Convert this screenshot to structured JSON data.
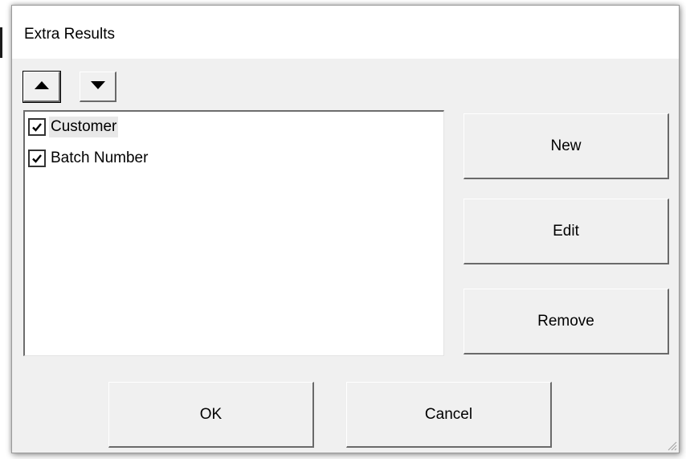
{
  "dialog": {
    "title": "Extra Results"
  },
  "toolbar": {
    "move_up_icon": "triangle-up-icon",
    "move_down_icon": "triangle-down-icon"
  },
  "results_list": {
    "items": [
      {
        "label": "Customer",
        "checked": true,
        "selected": true
      },
      {
        "label": "Batch Number",
        "checked": true,
        "selected": false
      }
    ]
  },
  "side_buttons": {
    "new_label": "New",
    "edit_label": "Edit",
    "remove_label": "Remove"
  },
  "footer_buttons": {
    "ok_label": "OK",
    "cancel_label": "Cancel"
  },
  "colors": {
    "dialog_background": "#f0f0f0",
    "title_background": "#ffffff",
    "list_background": "#ffffff",
    "selection_highlight": "#e8e8e8"
  }
}
